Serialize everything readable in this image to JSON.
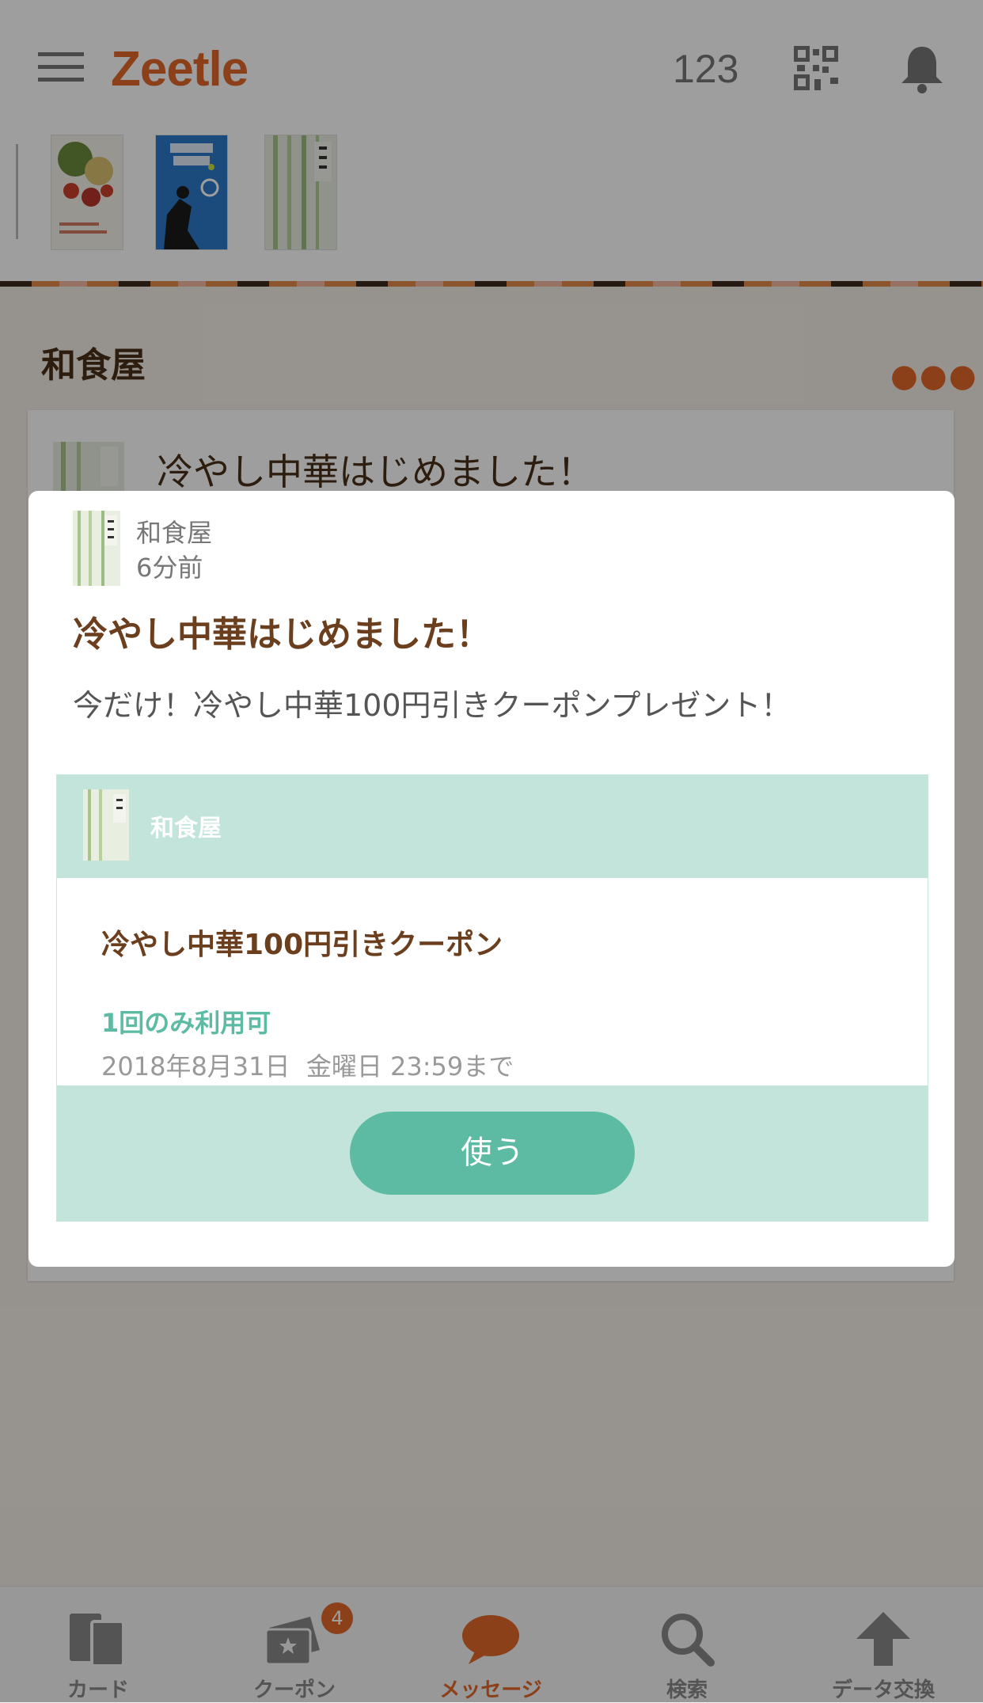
{
  "header": {
    "logo": "Zeetle",
    "count": "123"
  },
  "section": {
    "title": "和食屋"
  },
  "background_message": {
    "title": "冷やし中華はじめました！"
  },
  "modal": {
    "shop_name": "和食屋",
    "time_ago": "6分前",
    "title": "冷やし中華はじめました！",
    "body": "今だけ！冷やし中華100円引きクーポンプレゼント！",
    "coupon": {
      "shop_name": "和食屋",
      "title": "冷やし中華100円引きクーポン",
      "usage": "1回のみ利用可",
      "expiry": "2018年8月31日  金曜日 23:59まで",
      "use_label": "使う"
    }
  },
  "nav": {
    "items": [
      {
        "label": "カード",
        "icon": "card-icon"
      },
      {
        "label": "クーポン",
        "icon": "coupon-icon",
        "badge": "4"
      },
      {
        "label": "メッセージ",
        "icon": "message-icon"
      },
      {
        "label": "検索",
        "icon": "search-icon"
      },
      {
        "label": "データ交換",
        "icon": "upload-icon"
      }
    ]
  },
  "colors": {
    "brand": "#e0682a",
    "coupon_mint": "#c2e4db",
    "button": "#5dbba4",
    "text_brown": "#6b3e1e"
  }
}
